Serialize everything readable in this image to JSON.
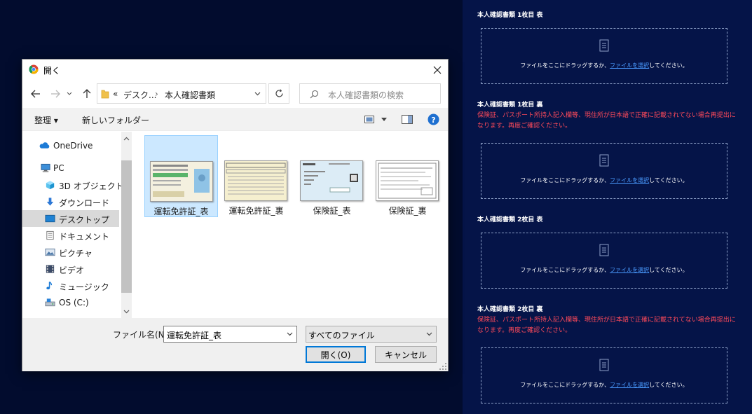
{
  "dialog": {
    "title": "開く",
    "breadcrumb": {
      "overflow": "«",
      "parent": "デスク...",
      "separator": "›",
      "current": "本人確認書類"
    },
    "search_placeholder": "本人確認書類の検索",
    "toolbar": {
      "organize": "整理 ▾",
      "new_folder": "新しいフォルダー"
    },
    "nav_items": [
      {
        "label": "OneDrive",
        "icon": "cloud-icon"
      },
      {
        "label": "PC",
        "icon": "computer-icon"
      },
      {
        "label": "3D オブジェクト",
        "icon": "cube-icon"
      },
      {
        "label": "ダウンロード",
        "icon": "download-icon"
      },
      {
        "label": "デスクトップ",
        "icon": "desktop-icon",
        "selected": true
      },
      {
        "label": "ドキュメント",
        "icon": "document-icon"
      },
      {
        "label": "ピクチャ",
        "icon": "picture-icon"
      },
      {
        "label": "ビデオ",
        "icon": "video-icon"
      },
      {
        "label": "ミュージック",
        "icon": "music-icon"
      },
      {
        "label": "OS (C:)",
        "icon": "drive-icon"
      }
    ],
    "files": [
      {
        "name": "運転免許証_表",
        "selected": true
      },
      {
        "name": "運転免許証_裏"
      },
      {
        "name": "保険証_表"
      },
      {
        "name": "保険証_裏"
      }
    ],
    "filename_label": "ファイル名(N):",
    "filename_value": "運転免許証_表",
    "filetype_value": "すべてのファイル",
    "open_button": "開く(O)",
    "cancel_button": "キャンセル"
  },
  "page": {
    "sections": [
      {
        "title": "本人確認書類 1枚目 表"
      },
      {
        "title": "本人確認書類 1枚目 裏",
        "warning": "保険証、パスポート所持人記入欄等、現住所が日本語で正確に記載されてない場合再提出になります。再度ご確認ください。"
      },
      {
        "title": "本人確認書類 2枚目 表"
      },
      {
        "title": "本人確認書類 2枚目 裏",
        "warning": "保険証、パスポート所持人記入欄等、現住所が日本語で正確に記載されてない場合再提出になります。再度ご確認ください。"
      }
    ],
    "dropzone": {
      "before": "ファイルをここにドラッグするか、",
      "link": "ファイルを選択",
      "after": "してください。"
    }
  },
  "colors": {
    "page_bg": "#020c2e",
    "panel_bg": "#051448",
    "warning": "#ff4a5a",
    "link": "#4a9bff",
    "selection": "#cce8ff",
    "accent": "#0078d7"
  }
}
